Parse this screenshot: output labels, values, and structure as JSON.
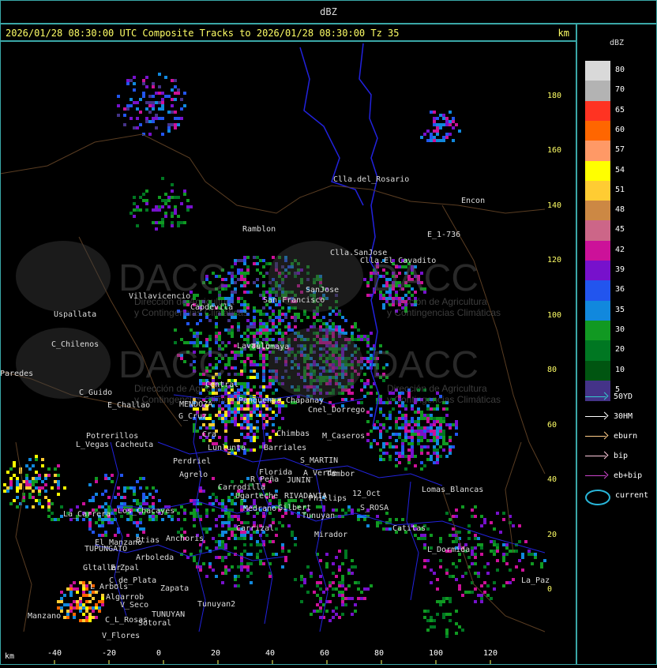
{
  "top_title": "dBZ",
  "header": {
    "title": "2026/01/28 08:30:00 UTC Composite Tracks to 2026/01/28 08:30:00 Tz 35",
    "unit": "km"
  },
  "legend": {
    "title": "dBZ",
    "scale": [
      {
        "value": "80",
        "color": "#d9d9d9"
      },
      {
        "value": "70",
        "color": "#b3b3b3"
      },
      {
        "value": "65",
        "color": "#ff3322"
      },
      {
        "value": "60",
        "color": "#ff6600"
      },
      {
        "value": "57",
        "color": "#ff9966"
      },
      {
        "value": "54",
        "color": "#ffff00"
      },
      {
        "value": "51",
        "color": "#ffcc33"
      },
      {
        "value": "48",
        "color": "#cc8844"
      },
      {
        "value": "45",
        "color": "#cc6688"
      },
      {
        "value": "42",
        "color": "#cc1199"
      },
      {
        "value": "39",
        "color": "#7711cc"
      },
      {
        "value": "36",
        "color": "#2255ee"
      },
      {
        "value": "35",
        "color": "#1188dd"
      },
      {
        "value": "30",
        "color": "#119922"
      },
      {
        "value": "20",
        "color": "#007722"
      },
      {
        "value": "10",
        "color": "#005511"
      },
      {
        "value": "5",
        "color": "#443388"
      }
    ],
    "tracks": [
      {
        "name": "50YD",
        "color": "#33cccc"
      },
      {
        "name": "30HM",
        "color": "#ffffff"
      },
      {
        "name": "eburn",
        "color": "#ffcc88"
      },
      {
        "name": "bip",
        "color": "#ffccdd"
      },
      {
        "name": "eb+bip",
        "color": "#cc44cc"
      }
    ],
    "current_label": "current"
  },
  "axes": {
    "y_ticks": [
      "180",
      "160",
      "140",
      "120",
      "100",
      "80",
      "60",
      "40",
      "20",
      "0"
    ],
    "x_ticks": [
      "-40",
      "-20",
      "0",
      "20",
      "40",
      "60",
      "80",
      "100",
      "120"
    ],
    "x_unit": "km"
  },
  "watermark": {
    "text": "DACC",
    "sub1": "Dirección de Agricultura",
    "sub2": "y Contingencias Climáticas"
  },
  "places": [
    {
      "name": "Clla.del_Rosario"
    },
    {
      "name": "Encon"
    },
    {
      "name": "Ramblon"
    },
    {
      "name": "E_1-736"
    },
    {
      "name": "Clla.SanJose"
    },
    {
      "name": "Clla.El_Cavadito"
    },
    {
      "name": "Villavicencio"
    },
    {
      "name": "Capdevila"
    },
    {
      "name": "San Francisco"
    },
    {
      "name": "SanJose"
    },
    {
      "name": "Uspallata"
    },
    {
      "name": "C_Chilenos"
    },
    {
      "name": "Lavalle"
    },
    {
      "name": "Paredes"
    },
    {
      "name": "C_Guido"
    },
    {
      "name": "E_Challao"
    },
    {
      "name": "MENDOZA"
    },
    {
      "name": "G_Cruz"
    },
    {
      "name": "Central"
    },
    {
      "name": "Chapanay"
    },
    {
      "name": "Chimbas"
    },
    {
      "name": "M_Caseros"
    },
    {
      "name": "Potrerillos"
    },
    {
      "name": "L_Vegas"
    },
    {
      "name": "Cacheuta"
    },
    {
      "name": "Perdriel"
    },
    {
      "name": "Lunlunta"
    },
    {
      "name": "Barriales"
    },
    {
      "name": "S_MARTIN"
    },
    {
      "name": "A_Verde"
    },
    {
      "name": "Tambor"
    },
    {
      "name": "Agrelo"
    },
    {
      "name": "R_Peña"
    },
    {
      "name": "JUNIN"
    },
    {
      "name": "RIVADAVIA"
    },
    {
      "name": "Phillips"
    },
    {
      "name": "12_Oct"
    },
    {
      "name": "Lomas_Blancas"
    },
    {
      "name": "Ugarteche"
    },
    {
      "name": "Medrano"
    },
    {
      "name": "Gilbert"
    },
    {
      "name": "S_ROSA"
    },
    {
      "name": "La_Carrera"
    },
    {
      "name": "Carrodilla"
    },
    {
      "name": "Florida"
    },
    {
      "name": "Tunuyan"
    },
    {
      "name": "Catitas"
    },
    {
      "name": "Los_Chacayes"
    },
    {
      "name": "Anchoris"
    },
    {
      "name": "Carrizal"
    },
    {
      "name": "Mirador"
    },
    {
      "name": "El_Manzano"
    },
    {
      "name": "TUPUNGATO"
    },
    {
      "name": "L_Dormida"
    },
    {
      "name": "Gltallar"
    },
    {
      "name": "E_Zpal"
    },
    {
      "name": "Arboleda"
    },
    {
      "name": "C_de_Plata"
    },
    {
      "name": "L_Arbols"
    },
    {
      "name": "Algarrob"
    },
    {
      "name": "Zapata"
    },
    {
      "name": "Manzano"
    },
    {
      "name": "V_Seco"
    },
    {
      "name": "TUNUYAN"
    },
    {
      "name": "C_L_Rosas"
    },
    {
      "name": "Sotoral"
    },
    {
      "name": "V_Flores"
    },
    {
      "name": "Btias"
    },
    {
      "name": "Tulumaya"
    },
    {
      "name": "Cra"
    },
    {
      "name": "Panquehua"
    },
    {
      "name": "Cnel_Dorrego"
    },
    {
      "name": "La_Paz"
    },
    {
      "name": "Tunuyan2"
    }
  ]
}
